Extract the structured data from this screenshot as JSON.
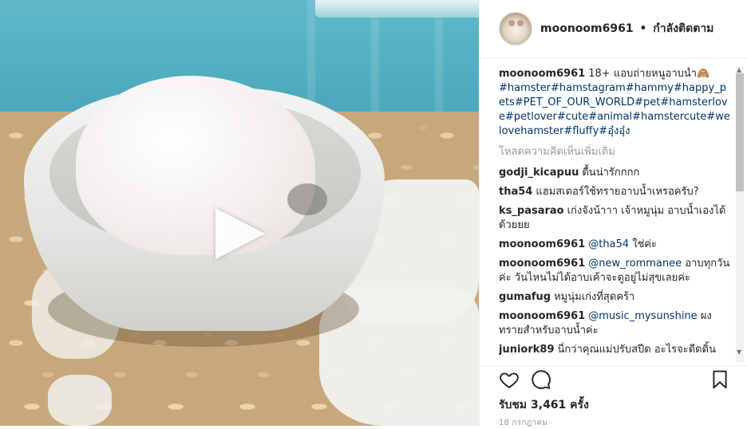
{
  "post": {
    "username": "moonoom6961",
    "separator": "•",
    "follow_status": "กำลังติดตาม",
    "caption_user": "moonoom6961",
    "caption_text": "18+ แอบถ่ายหนูอาบน้ำ🙈",
    "hashtags": "#hamster#hamstagram#hammy#happy_pets#PET_OF_OUR_WORLD#pet#hamsterlove#petlover#cute#animal#hamstercute#welovehamster#fluffy#อุ๋งอุ๋ง",
    "load_more": "โหลดความคิดเห็นเพิ่มเติม",
    "views": "รับชม 3,461 ครั้ง",
    "date": "18 กรกฎาคม"
  },
  "comments": [
    {
      "user": "godji_kicapuu",
      "mention": "",
      "text": "ดื้นน่ารักกกก"
    },
    {
      "user": "tha54",
      "mention": "",
      "text": "แฮมสเตอร์ใช้ทรายอาบน้ำเหรอครับ?"
    },
    {
      "user": "ks_pasarao",
      "mention": "",
      "text": "เก่งจังน้าาา เจ้าหมูนุ่ม อาบน้ำเองได้ด้วยยย"
    },
    {
      "user": "moonoom6961",
      "mention": "@tha54",
      "text": "ใช่ค่ะ"
    },
    {
      "user": "moonoom6961",
      "mention": "@new_rommanee",
      "text": "อาบทุกวันค่ะ วันไหนไม่ได้อาบเค้าจะดูอยู่ไม่สุขเลยค่ะ"
    },
    {
      "user": "gumafug",
      "mention": "",
      "text": "หมูนุ่มเก่งที่สุดคร้า"
    },
    {
      "user": "moonoom6961",
      "mention": "@music_mysunshine",
      "text": "ผงทรายสำหรับอาบน้ำค่ะ"
    },
    {
      "user": "juniork89",
      "mention": "",
      "text": "นี่กว่าคุณแม่ปรับสปีด อะไรจะดีดดิ้น"
    }
  ],
  "icons": {
    "play": "play-icon",
    "like": "heart-icon",
    "comment": "comment-icon",
    "save": "bookmark-icon"
  },
  "colors": {
    "link": "#003569",
    "muted": "#999999",
    "text": "#262626"
  }
}
